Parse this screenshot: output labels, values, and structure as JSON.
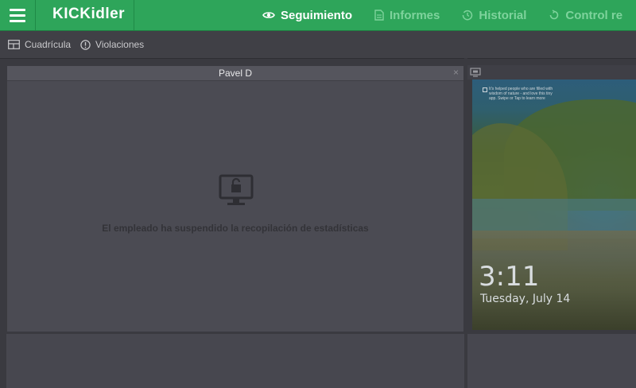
{
  "app": {
    "logo": "KICKidler"
  },
  "nav": {
    "items": [
      {
        "label": "Seguimiento",
        "icon": "eye-icon",
        "active": true
      },
      {
        "label": "Informes",
        "icon": "document-icon",
        "active": false
      },
      {
        "label": "Historial",
        "icon": "history-icon",
        "active": false
      },
      {
        "label": "Control re",
        "icon": "refresh-icon",
        "active": false
      }
    ]
  },
  "toolbar": {
    "grid_label": "Cuadrícula",
    "violations_label": "Violaciones"
  },
  "panel_left": {
    "title": "Pavel D",
    "close": "×",
    "status_message": "El empleado ha suspendido la recopilación de estadísticas"
  },
  "panel_right": {
    "tip_text": "It's helped people who are filled with wisdom of nature - and love this tiny app. Swipe or Tap to learn more",
    "lock_time": "3:11",
    "lock_date": "Tuesday, July 14"
  },
  "colors": {
    "accent": "#2ea55a",
    "background": "#3a3a40",
    "panel": "#4b4b53"
  }
}
